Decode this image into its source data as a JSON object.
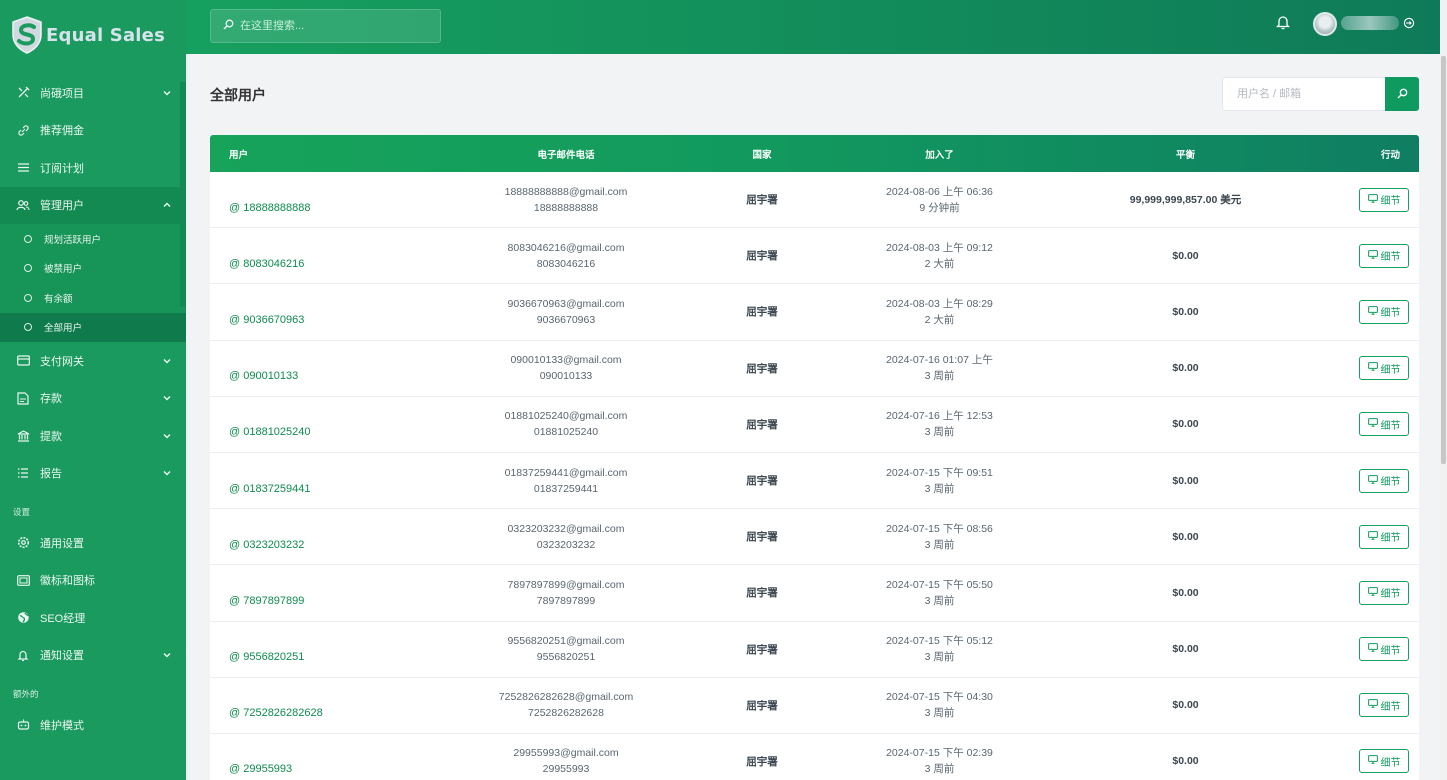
{
  "brand": {
    "name": "Equal Sales"
  },
  "topbar": {
    "search_placeholder": "在这里搜索..."
  },
  "sidebar": {
    "items": [
      {
        "label": "尚硪项目",
        "icon": "tools-icon",
        "has_children": true
      },
      {
        "label": "推荐佣金",
        "icon": "link-icon",
        "has_children": false
      },
      {
        "label": "订阅计划",
        "icon": "list-icon",
        "has_children": false
      },
      {
        "label": "管理用户",
        "icon": "users-icon",
        "has_children": true,
        "expanded": true
      },
      {
        "label": "支付网关",
        "icon": "card-icon",
        "has_children": true
      },
      {
        "label": "存款",
        "icon": "deposit-icon",
        "has_children": true
      },
      {
        "label": "提款",
        "icon": "bank-icon",
        "has_children": true
      },
      {
        "label": "报告",
        "icon": "report-icon",
        "has_children": true
      }
    ],
    "users_submenu": [
      "规划活跃用户",
      "被禁用户",
      "有余额",
      "全部用户"
    ],
    "settings_label": "设置",
    "settings_items": [
      {
        "label": "通用设置",
        "icon": "gear-icon"
      },
      {
        "label": "徽标和图标",
        "icon": "image-icon"
      },
      {
        "label": "SEO经理",
        "icon": "globe-icon"
      },
      {
        "label": "通知设置",
        "icon": "bell-icon",
        "has_children": true
      }
    ],
    "extra_label": "额外的",
    "extra_items": [
      {
        "label": "维护模式",
        "icon": "robot-icon"
      }
    ]
  },
  "page": {
    "title": "全部用户",
    "filter_placeholder": "用户名 / 邮箱"
  },
  "table": {
    "headers": {
      "user": "用户",
      "email": "电子邮件电话",
      "country": "国家",
      "joined": "加入了",
      "balance": "平衡",
      "action": "行动"
    },
    "detail_label": "细节",
    "rows": [
      {
        "user": "@ 18888888888",
        "email": "18888888888@gmail.com",
        "phone": "18888888888",
        "country": "屈宇署",
        "joined_date": "2024-08-06 上午 06:36",
        "joined_ago": "9 分钟前",
        "balance": "99,999,999,857.00 美元"
      },
      {
        "user": "@ 8083046216",
        "email": "8083046216@gmail.com",
        "phone": "8083046216",
        "country": "屈宇署",
        "joined_date": "2024-08-03 上午 09:12",
        "joined_ago": "2 大前",
        "balance": "$0.00"
      },
      {
        "user": "@ 9036670963",
        "email": "9036670963@gmail.com",
        "phone": "9036670963",
        "country": "屈宇署",
        "joined_date": "2024-08-03 上午 08:29",
        "joined_ago": "2 大前",
        "balance": "$0.00"
      },
      {
        "user": "@ 090010133",
        "email": "090010133@gmail.com",
        "phone": "090010133",
        "country": "屈宇署",
        "joined_date": "2024-07-16 01:07 上午",
        "joined_ago": "3 周前",
        "balance": "$0.00"
      },
      {
        "user": "@ 01881025240",
        "email": "01881025240@gmail.com",
        "phone": "01881025240",
        "country": "屈宇署",
        "joined_date": "2024-07-16 上午 12:53",
        "joined_ago": "3 周前",
        "balance": "$0.00"
      },
      {
        "user": "@ 01837259441",
        "email": "01837259441@gmail.com",
        "phone": "01837259441",
        "country": "屈宇署",
        "joined_date": "2024-07-15 下午 09:51",
        "joined_ago": "3 周前",
        "balance": "$0.00"
      },
      {
        "user": "@ 0323203232",
        "email": "0323203232@gmail.com",
        "phone": "0323203232",
        "country": "屈宇署",
        "joined_date": "2024-07-15 下午 08:56",
        "joined_ago": "3 周前",
        "balance": "$0.00"
      },
      {
        "user": "@ 7897897899",
        "email": "7897897899@gmail.com",
        "phone": "7897897899",
        "country": "屈宇署",
        "joined_date": "2024-07-15 下午 05:50",
        "joined_ago": "3 周前",
        "balance": "$0.00"
      },
      {
        "user": "@ 9556820251",
        "email": "9556820251@gmail.com",
        "phone": "9556820251",
        "country": "屈宇署",
        "joined_date": "2024-07-15 下午 05:12",
        "joined_ago": "3 周前",
        "balance": "$0.00"
      },
      {
        "user": "@ 7252826282628",
        "email": "7252826282628@gmail.com",
        "phone": "7252826282628",
        "country": "屈宇署",
        "joined_date": "2024-07-15 下午 04:30",
        "joined_ago": "3 周前",
        "balance": "$0.00"
      },
      {
        "user": "@ 29955993",
        "email": "29955993@gmail.com",
        "phone": "29955993",
        "country": "屈宇署",
        "joined_date": "2024-07-15 下午 02:39",
        "joined_ago": "3 周前",
        "balance": "$0.00"
      }
    ]
  },
  "colors": {
    "primary": "#1a9a5f",
    "primary_dark": "#0f7a4b",
    "accent_text": "#0f8b4f"
  }
}
